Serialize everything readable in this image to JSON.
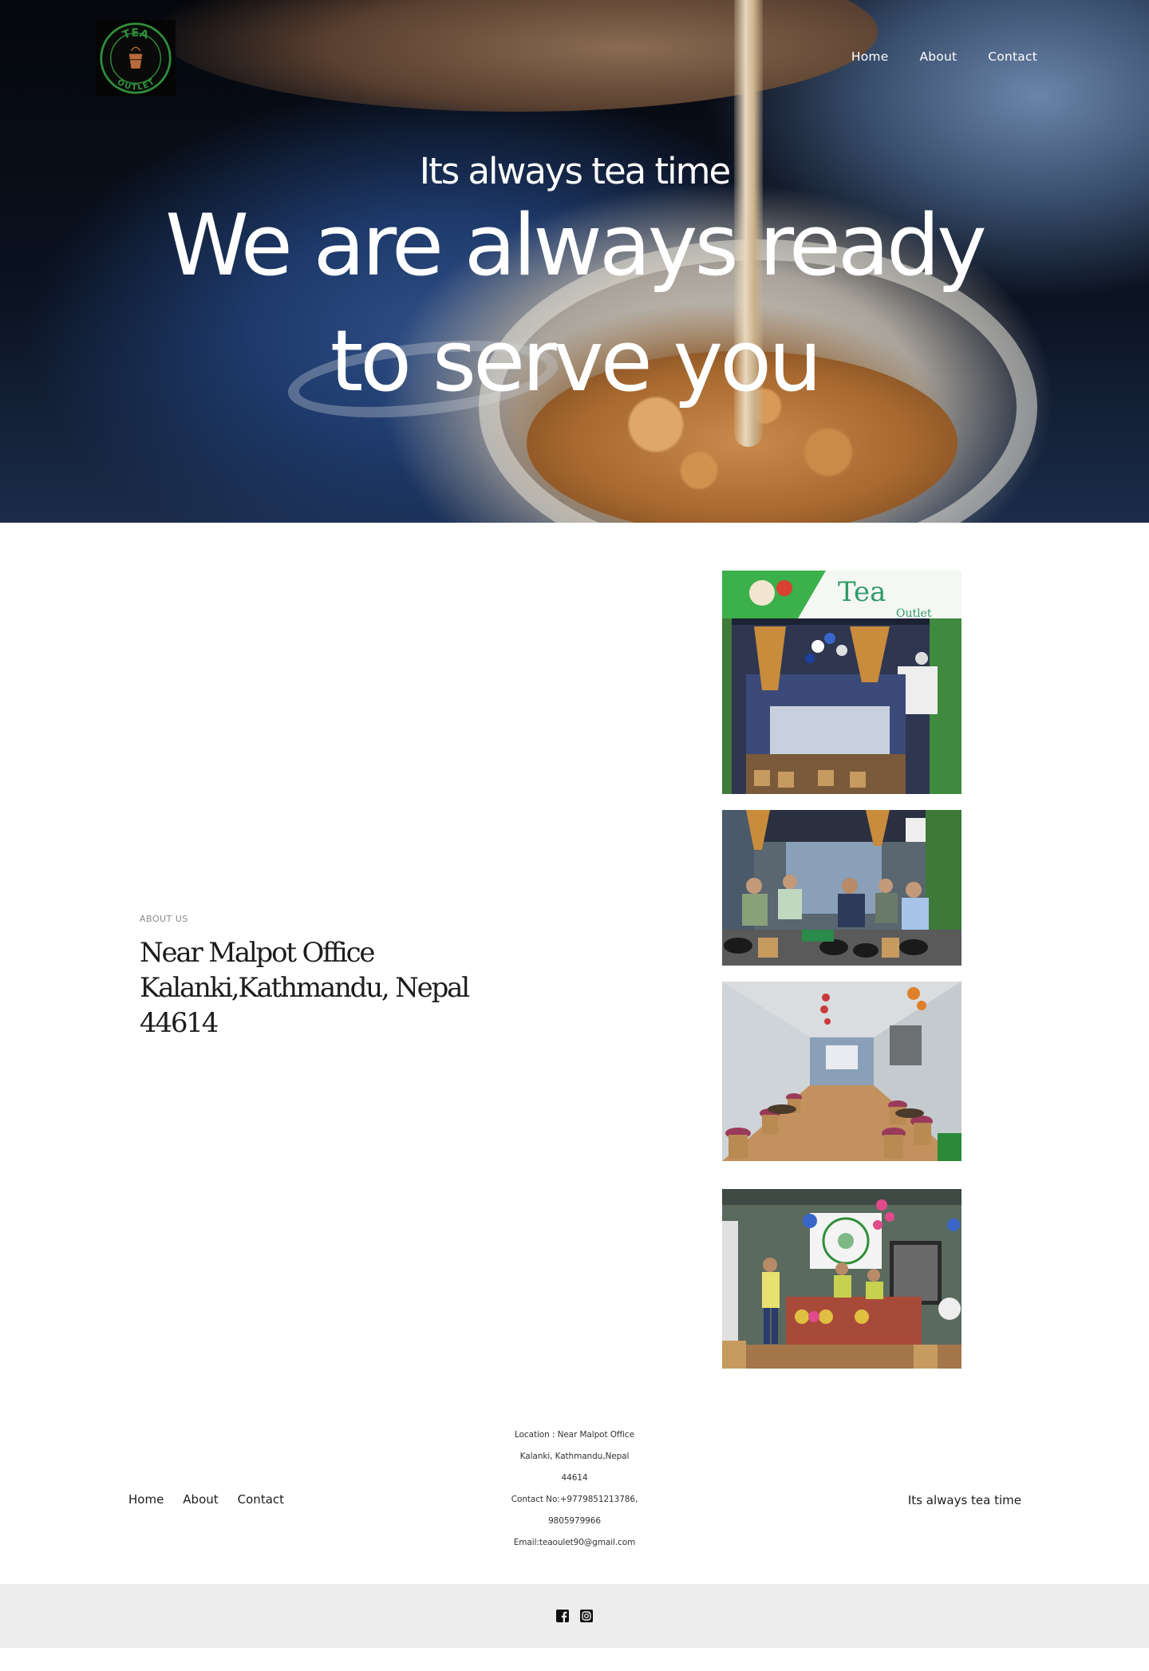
{
  "header": {
    "logo_alt": "Tea Outlet",
    "logo_text_top": "TEA",
    "logo_text_bottom": "OUTLET",
    "nav": [
      {
        "label": "Home"
      },
      {
        "label": "About"
      },
      {
        "label": "Contact"
      }
    ]
  },
  "hero": {
    "subtitle": "Its always tea time",
    "title_line1": "We are always ready",
    "title_line2": "to serve you"
  },
  "about": {
    "label": "ABOUT US",
    "address_line1": "Near Malpot Office",
    "address_line2": "Kalanki,Kathmandu, Nepal",
    "address_line3": "44614",
    "photo1_sign": "Tea",
    "photo1_sign_sub": "Outlet"
  },
  "footer": {
    "nav": [
      {
        "label": "Home"
      },
      {
        "label": "About"
      },
      {
        "label": "Contact"
      }
    ],
    "info": [
      "Location : Near Malpot Office",
      "Kalanki, Kathmandu,Nepal",
      "44614",
      "Contact No:+9779851213786,",
      "9805979966",
      "Email:teaoulet90@gmail.com"
    ],
    "tagline": "Its always tea time"
  },
  "social": [
    {
      "icon": "facebook-icon"
    },
    {
      "icon": "instagram-icon"
    }
  ],
  "colors": {
    "brand_green": "#2f8f3a",
    "footer_bar": "#ededed"
  }
}
